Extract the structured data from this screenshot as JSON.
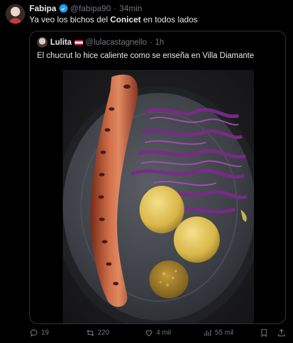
{
  "author": {
    "name": "Fabipa",
    "handle": "@fabipa90",
    "time": "34min"
  },
  "tweet": {
    "text_before": "Ya veo los bichos del ",
    "text_bold": "Conicet",
    "text_after": " en todos lados"
  },
  "quoted": {
    "name": "Lulita",
    "handle": "@lulacastagnello",
    "time": "1h",
    "text": "El chucrut lo hice caliente como se enseña en Villa Diamante"
  },
  "actions": {
    "replies": "19",
    "retweets": "220",
    "likes": "4 mil",
    "views": "55 mil"
  },
  "icons": [
    "reply-icon",
    "retweet-icon",
    "like-icon",
    "views-icon",
    "bookmark-icon",
    "share-icon",
    "verified-icon"
  ],
  "colors": {
    "background": "#000000",
    "text": "#e7e9ea",
    "muted": "#71767b",
    "verified": "#1d9bf0",
    "border": "#2f3336"
  }
}
